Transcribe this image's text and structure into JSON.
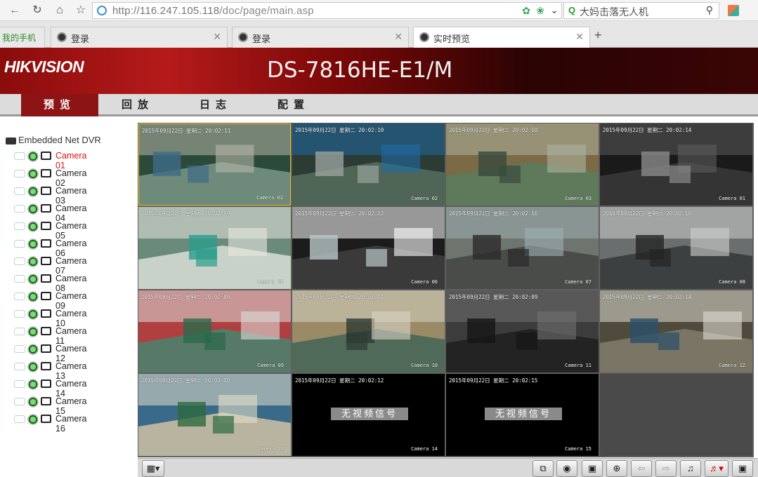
{
  "browser": {
    "url_host": "http://116.247.105.118",
    "url_path": "/doc/page/main.asp",
    "search_placeholder": "大妈击落无人机",
    "tabs": [
      {
        "label": "我的手机"
      },
      {
        "label": "登录"
      },
      {
        "label": "登录"
      },
      {
        "label": "实时预览"
      }
    ]
  },
  "header": {
    "brand": "HIKVISION",
    "model": "DS-7816HE-E1/M"
  },
  "nav": [
    {
      "label": "预览"
    },
    {
      "label": "回放"
    },
    {
      "label": "日志"
    },
    {
      "label": "配置"
    }
  ],
  "sidebar": {
    "root_label": "Embedded Net DVR",
    "cameras": [
      {
        "label": "Camera 01",
        "selected": true
      },
      {
        "label": "Camera 02"
      },
      {
        "label": "Camera 03"
      },
      {
        "label": "Camera 04"
      },
      {
        "label": "Camera 05"
      },
      {
        "label": "Camera 06"
      },
      {
        "label": "Camera 07"
      },
      {
        "label": "Camera 08"
      },
      {
        "label": "Camera 09"
      },
      {
        "label": "Camera 10"
      },
      {
        "label": "Camera 11"
      },
      {
        "label": "Camera 12"
      },
      {
        "label": "Camera 13"
      },
      {
        "label": "Camera 14"
      },
      {
        "label": "Camera 15"
      },
      {
        "label": "Camera 16"
      }
    ]
  },
  "feeds": [
    {
      "timestamp": "2015年09月22日 星期二 20:02:11",
      "camera": "Camera 01",
      "no_signal": ""
    },
    {
      "timestamp": "2015年09月22日 星期二 20:02:10",
      "camera": "Camera 02",
      "no_signal": ""
    },
    {
      "timestamp": "2015年09月22日 星期二 20:02:10",
      "camera": "Camera 03",
      "no_signal": ""
    },
    {
      "timestamp": "2015年09月22日 星期二 20:02:14",
      "camera": "Camera 01",
      "no_signal": ""
    },
    {
      "timestamp": "2015年09月22日 星期二 20:02:09",
      "camera": "Camera 05",
      "no_signal": ""
    },
    {
      "timestamp": "2015年09月22日 星期二 20:02:12",
      "camera": "Camera 06",
      "no_signal": ""
    },
    {
      "timestamp": "2015年09月22日 星期二 20:02:16",
      "camera": "Camera 07",
      "no_signal": ""
    },
    {
      "timestamp": "2015年09月22日 星期二 20:02:10",
      "camera": "Camera 08",
      "no_signal": ""
    },
    {
      "timestamp": "2015年09月22日 星期二 20:02:09",
      "camera": "Camera 09",
      "no_signal": ""
    },
    {
      "timestamp": "2015年09月22日 星期二 20:02:14",
      "camera": "Camera 10",
      "no_signal": ""
    },
    {
      "timestamp": "2015年09月22日 星期二 20:02:09",
      "camera": "Camera 11",
      "no_signal": ""
    },
    {
      "timestamp": "2015年09月22日 星期二 20:02:14",
      "camera": "Camera 12",
      "no_signal": ""
    },
    {
      "timestamp": "2015年09月22日 星期二 20:02:10",
      "camera": "Camera 13",
      "no_signal": ""
    },
    {
      "timestamp": "2015年09月22日 星期二 20:02:12",
      "camera": "Camera 14",
      "no_signal": "无视频信号"
    },
    {
      "timestamp": "2015年09月22日 星期二 20:02:15",
      "camera": "Camera 15",
      "no_signal": "无视频信号"
    }
  ],
  "toolbar": {
    "icons": [
      "layout-icon",
      "stop-all-icon",
      "capture-icon",
      "record-icon",
      "zoom-icon",
      "prev-icon",
      "next-icon",
      "mic-icon",
      "volume-icon",
      "fullscreen-icon"
    ]
  },
  "colors": {
    "brand_red": "#8c1414",
    "selected_camera": "#d9141a",
    "selected_border": "#f3c21c"
  }
}
